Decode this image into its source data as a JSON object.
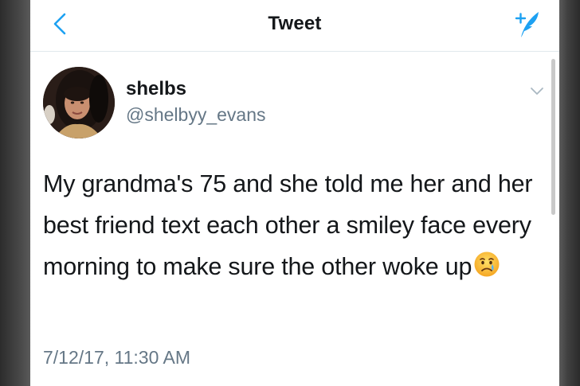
{
  "navbar": {
    "title": "Tweet",
    "back_icon": "chevron-left-icon",
    "compose_icon": "compose-feather-icon",
    "accent_color": "#1da1f2"
  },
  "tweet": {
    "author": {
      "display_name": "shelbs",
      "handle": "@shelbyy_evans"
    },
    "text": "My grandma's 75 and she told me her and her best friend text each other a smiley face every morning to make sure the other woke up",
    "emoji": "crying-face-emoji",
    "timestamp": "7/12/17, 11:30 AM",
    "menu_icon": "chevron-down-icon"
  }
}
